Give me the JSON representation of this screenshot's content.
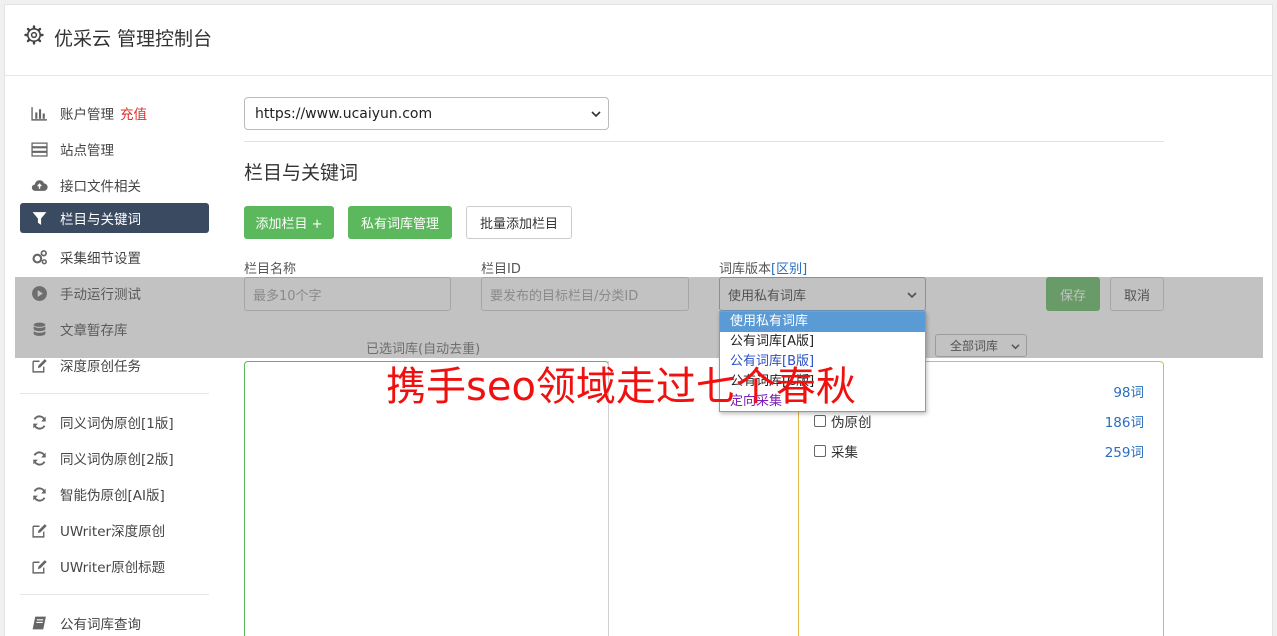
{
  "header": {
    "title": "优采云 管理控制台",
    "icon": "gear-icon"
  },
  "sidebar": {
    "items": [
      {
        "label": "账户管理",
        "extra": "充值",
        "icon": "bar-chart-icon"
      },
      {
        "label": "站点管理",
        "icon": "server-icon"
      },
      {
        "label": "接口文件相关",
        "icon": "cloud-upload-icon"
      },
      {
        "label": "栏目与关键词",
        "icon": "filter-icon",
        "active": true
      },
      {
        "label": "采集细节设置",
        "icon": "gears-icon"
      },
      {
        "label": "手动运行测试",
        "icon": "play-circle-icon"
      },
      {
        "label": "文章暂存库",
        "icon": "database-icon"
      },
      {
        "label": "深度原创任务",
        "icon": "edit-icon"
      },
      {
        "label": "同义词伪原创[1版]",
        "icon": "refresh-icon"
      },
      {
        "label": "同义词伪原创[2版]",
        "icon": "refresh-icon"
      },
      {
        "label": "智能伪原创[AI版]",
        "icon": "refresh-icon"
      },
      {
        "label": "UWriter深度原创",
        "icon": "edit-icon"
      },
      {
        "label": "UWriter原创标题",
        "icon": "edit-icon"
      },
      {
        "label": "公有词库查询",
        "icon": "book-icon"
      }
    ]
  },
  "main": {
    "site_select": "https://www.ucaiyun.com",
    "section_title": "栏目与关键词",
    "buttons": {
      "add_column": "添加栏目 +",
      "private_lib": "私有词库管理",
      "batch_add": "批量添加栏目"
    },
    "fields": {
      "name_label": "栏目名称",
      "name_placeholder": "最多10个字",
      "id_label": "栏目ID",
      "id_placeholder": "要发布的目标栏目/分类ID",
      "version_label": "词库版本",
      "version_link": "[区别]",
      "version_value": "使用私有词库"
    },
    "save": "保存",
    "cancel": "取消",
    "dropdown_options": [
      "使用私有词库",
      "公有词库[A版]",
      "公有词库[B版]",
      "公有词库[C版]",
      "定向采集"
    ],
    "selected_label": "已选词库(自动去重)",
    "all_libs": "全部词库",
    "libraries": [
      {
        "name": "",
        "count": "98词"
      },
      {
        "name": "伪原创",
        "count": "186词"
      },
      {
        "name": "采集",
        "count": "259词"
      }
    ]
  },
  "watermark": "携手seo领域走过七个春秋",
  "colors": {
    "green": "#5cb85c",
    "nav_active": "#3a4a60",
    "link": "#2a6fbf",
    "watermark": "#f01010"
  }
}
